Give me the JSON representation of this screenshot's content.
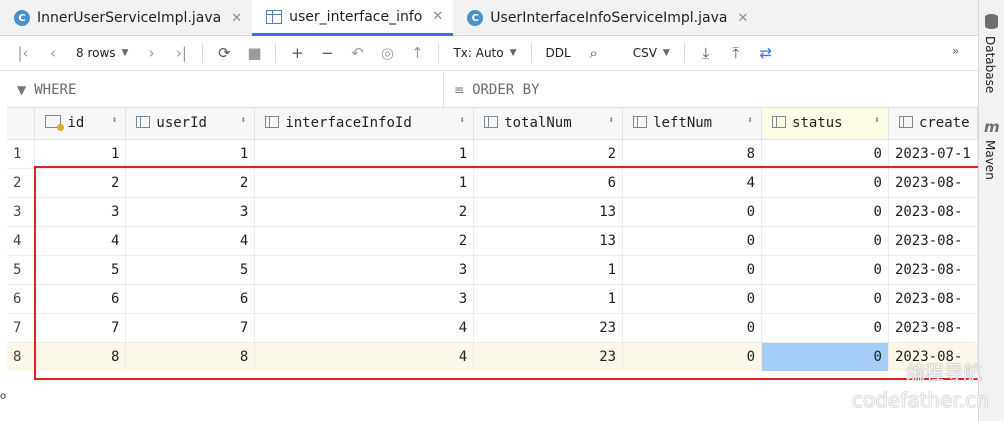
{
  "tabs": [
    {
      "label": "InnerUserServiceImpl.java",
      "icon": "java-class-icon",
      "active": false
    },
    {
      "label": "user_interface_info",
      "icon": "table-icon",
      "active": true
    },
    {
      "label": "UserInterfaceInfoServiceImpl.java",
      "icon": "java-class-icon",
      "active": false
    }
  ],
  "toolbar": {
    "rows_label": "8 rows",
    "tx_label": "Tx: Auto",
    "ddl_label": "DDL",
    "export_format": "CSV"
  },
  "filters": {
    "where_label": "WHERE",
    "order_label": "ORDER BY"
  },
  "table": {
    "columns": [
      "id",
      "userId",
      "interfaceInfoId",
      "totalNum",
      "leftNum",
      "status",
      "create"
    ],
    "rows": [
      {
        "n": "1",
        "id": "1",
        "userId": "1",
        "interfaceInfoId": "1",
        "totalNum": "2",
        "leftNum": "8",
        "status": "0",
        "create": "2023-07-1"
      },
      {
        "n": "2",
        "id": "2",
        "userId": "2",
        "interfaceInfoId": "1",
        "totalNum": "6",
        "leftNum": "4",
        "status": "0",
        "create": "2023-08-"
      },
      {
        "n": "3",
        "id": "3",
        "userId": "3",
        "interfaceInfoId": "2",
        "totalNum": "13",
        "leftNum": "0",
        "status": "0",
        "create": "2023-08-"
      },
      {
        "n": "4",
        "id": "4",
        "userId": "4",
        "interfaceInfoId": "2",
        "totalNum": "13",
        "leftNum": "0",
        "status": "0",
        "create": "2023-08-"
      },
      {
        "n": "5",
        "id": "5",
        "userId": "5",
        "interfaceInfoId": "3",
        "totalNum": "1",
        "leftNum": "0",
        "status": "0",
        "create": "2023-08-"
      },
      {
        "n": "6",
        "id": "6",
        "userId": "6",
        "interfaceInfoId": "3",
        "totalNum": "1",
        "leftNum": "0",
        "status": "0",
        "create": "2023-08-"
      },
      {
        "n": "7",
        "id": "7",
        "userId": "7",
        "interfaceInfoId": "4",
        "totalNum": "23",
        "leftNum": "0",
        "status": "0",
        "create": "2023-08-"
      },
      {
        "n": "8",
        "id": "8",
        "userId": "8",
        "interfaceInfoId": "4",
        "totalNum": "23",
        "leftNum": "0",
        "status": "0",
        "create": "2023-08-"
      }
    ]
  },
  "sidebar": {
    "database_label": "Database",
    "maven_label": "Maven"
  },
  "watermark": {
    "line1": "编程导航",
    "line2": "codefather.cn"
  },
  "colors": {
    "accent": "#3574f0",
    "highlight": "#e02020",
    "selected_cell": "#a5cdf9",
    "selected_row": "#fbf8e9"
  }
}
